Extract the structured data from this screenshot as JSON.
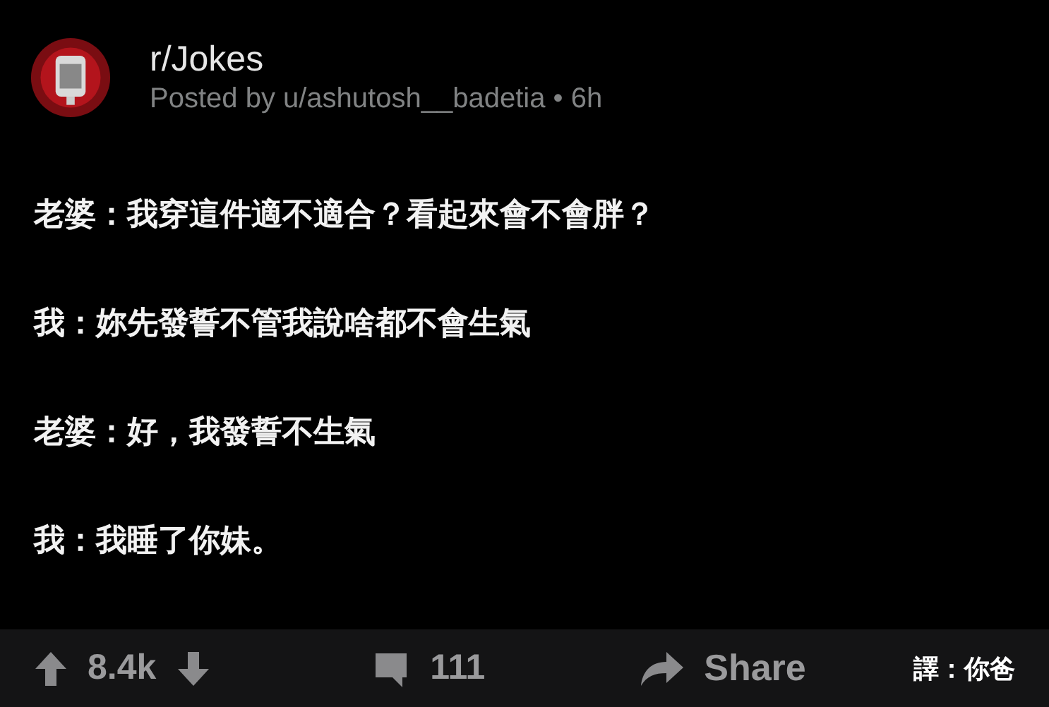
{
  "post": {
    "subreddit": "r/Jokes",
    "byline": "Posted by u/ashutosh__badetia • 6h"
  },
  "lines": [
    "老婆：我穿這件適不適合？看起來會不會胖？",
    "我：妳先發誓不管我說啥都不會生氣",
    "老婆：好，我發誓不生氣",
    "我：我睡了你妹。"
  ],
  "actions": {
    "votes": "8.4k",
    "comments": "111",
    "share": "Share"
  },
  "translator_credit": "譯：你爸"
}
